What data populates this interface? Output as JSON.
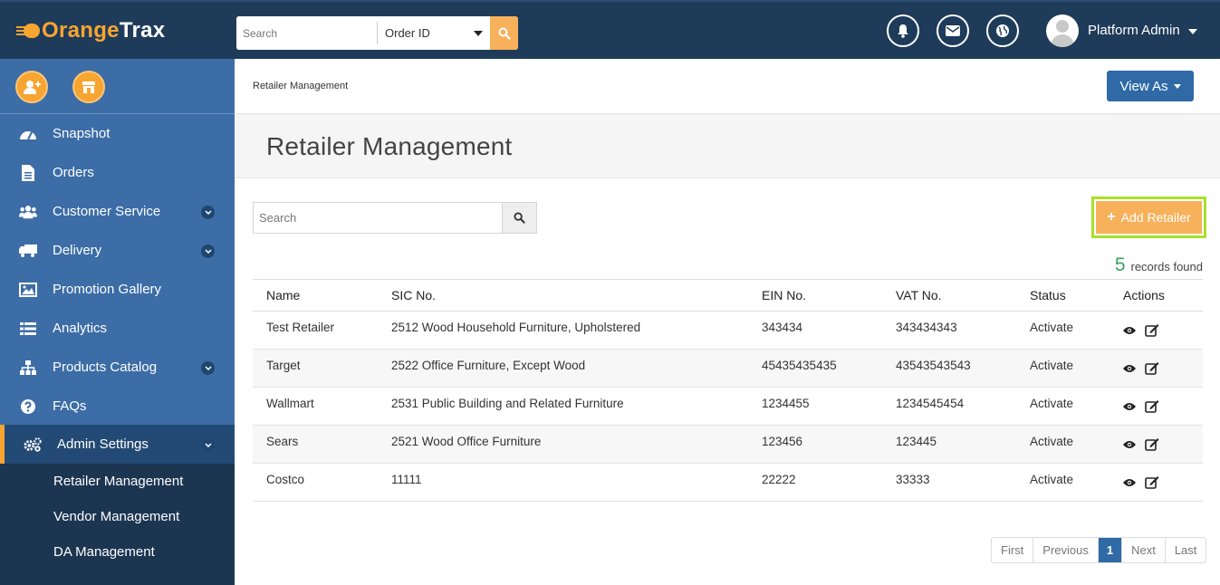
{
  "brand": {
    "part1": "Orange",
    "part2": "Trax"
  },
  "topbar": {
    "search_placeholder": "Search",
    "search_field": "Order ID",
    "user_name": "Platform Admin"
  },
  "sidebar": {
    "items": [
      {
        "label": "Snapshot"
      },
      {
        "label": "Orders"
      },
      {
        "label": "Customer Service"
      },
      {
        "label": "Delivery"
      },
      {
        "label": "Promotion Gallery"
      },
      {
        "label": "Analytics"
      },
      {
        "label": "Products Catalog"
      },
      {
        "label": "FAQs"
      },
      {
        "label": "Admin Settings"
      }
    ],
    "subitems": [
      {
        "label": "Retailer Management"
      },
      {
        "label": "Vendor Management"
      },
      {
        "label": "DA Management"
      }
    ]
  },
  "breadcrumb": "Retailer Management",
  "view_as_label": "View As",
  "page_title": "Retailer Management",
  "search_placeholder": "Search",
  "add_label": "Add Retailer",
  "records": {
    "count": "5",
    "label": "records found"
  },
  "table": {
    "headers": [
      "Name",
      "SIC No.",
      "EIN No.",
      "VAT No.",
      "Status",
      "Actions"
    ],
    "rows": [
      {
        "name": "Test Retailer",
        "sic": "2512 Wood Household Furniture, Upholstered",
        "ein": "343434",
        "vat": "343434343",
        "status": "Activate"
      },
      {
        "name": "Target",
        "sic": "2522 Office Furniture, Except Wood",
        "ein": "45435435435",
        "vat": "43543543543",
        "status": "Activate"
      },
      {
        "name": "Wallmart",
        "sic": "2531 Public Building and Related Furniture",
        "ein": "1234455",
        "vat": "1234545454",
        "status": "Activate"
      },
      {
        "name": "Sears",
        "sic": "2521 Wood Office Furniture",
        "ein": "123456",
        "vat": "123445",
        "status": "Activate"
      },
      {
        "name": "Costco",
        "sic": "11111",
        "ein": "22222",
        "vat": "33333",
        "status": "Activate"
      }
    ]
  },
  "pagination": {
    "first": "First",
    "previous": "Previous",
    "current": "1",
    "next": "Next",
    "last": "Last"
  },
  "colors": {
    "topbar": "#1f3b5a",
    "sidebar": "#3c6da6",
    "accent": "#f7a531",
    "primary": "#2f6aa6",
    "highlight": "#a8e02a"
  }
}
